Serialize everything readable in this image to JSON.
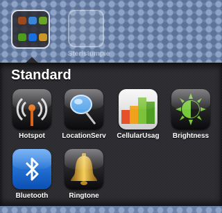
{
  "springboard": {
    "neighbor_app_label": "Steristumpie"
  },
  "folder": {
    "title": "Standard",
    "apps": [
      {
        "label": "Hotspot",
        "icon": "hotspot-icon"
      },
      {
        "label": "LocationServ",
        "icon": "location-pin-icon"
      },
      {
        "label": "CellularUsag",
        "icon": "cellular-usage-icon"
      },
      {
        "label": "Brightness",
        "icon": "brightness-icon"
      },
      {
        "label": "Bluetooth",
        "icon": "bluetooth-icon"
      },
      {
        "label": "Ringtone",
        "icon": "bell-icon"
      }
    ]
  },
  "colors": {
    "panel": "#2a2a2e",
    "wallpaper": "#6c82a8",
    "bluetooth_blue": "#1a6fe0"
  }
}
